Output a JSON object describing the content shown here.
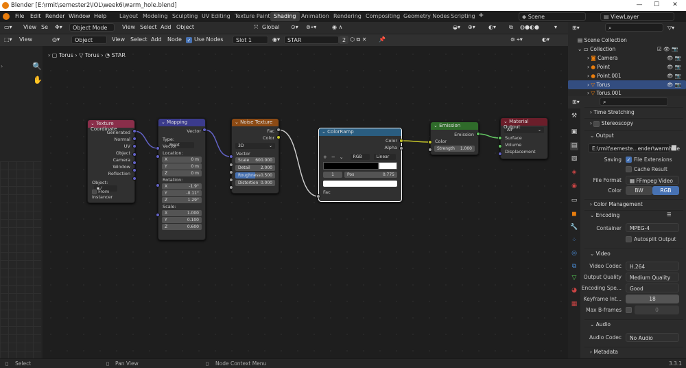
{
  "titlebar": {
    "title": "Blender [E:\\rmit\\semester2\\IOL\\week6\\warm_hole.blend]"
  },
  "menu": {
    "file": "File",
    "edit": "Edit",
    "render": "Render",
    "window": "Window",
    "help": "Help"
  },
  "workspaces": [
    "Layout",
    "Modeling",
    "Sculpting",
    "UV Editing",
    "Texture Paint",
    "Shading",
    "Animation",
    "Rendering",
    "Compositing",
    "Geometry Nodes",
    "Scripting"
  ],
  "top_right": {
    "scene": "Scene",
    "view_layer": "ViewLayer"
  },
  "viewport_header": {
    "view": "View",
    "se": "Se",
    "mode": "Object Mode",
    "view2": "View",
    "select": "Select",
    "add": "Add",
    "object": "Object",
    "transform": "Global"
  },
  "node_header": {
    "view": "View",
    "object": "Object",
    "view2": "View",
    "select": "Select",
    "add": "Add",
    "node": "Node",
    "use_nodes": "Use Nodes",
    "slot": "Slot 1",
    "material": "STAR",
    "users": "2"
  },
  "breadcrumb": {
    "object": "Torus",
    "mesh": "Torus",
    "material": "STAR"
  },
  "nodes": {
    "texcoord": {
      "title": "Texture Coordinate",
      "outputs": [
        "Generated",
        "Normal",
        "UV",
        "Object",
        "Camera",
        "Window",
        "Reflection"
      ],
      "object_label": "Object:",
      "from_instancer": "From Instancer"
    },
    "mapping": {
      "title": "Mapping",
      "output": "Vector",
      "type_label": "Type:",
      "type_value": "Point",
      "vector": "Vector",
      "location": "Location:",
      "loc": [
        [
          "X",
          "0 m"
        ],
        [
          "Y",
          "0 m"
        ],
        [
          "Z",
          "0 m"
        ]
      ],
      "rotation": "Rotation:",
      "rot": [
        [
          "X",
          "-1.9°"
        ],
        [
          "Y",
          "-0.11°"
        ],
        [
          "Z",
          "1.29°"
        ]
      ],
      "scale": "Scale:",
      "scl": [
        [
          "X",
          "1.000"
        ],
        [
          "Y",
          "0.100"
        ],
        [
          "Z",
          "0.600"
        ]
      ]
    },
    "noise": {
      "title": "Noise Texture",
      "fac": "Fac",
      "color": "Color",
      "dim": "3D",
      "vector": "Vector",
      "fields": [
        [
          "Scale",
          "600.000"
        ],
        [
          "Detail",
          "2.000"
        ],
        [
          "Roughness",
          "0.500"
        ],
        [
          "Distortion",
          "0.000"
        ]
      ],
      "roughness_fill": 0.5
    },
    "colorramp": {
      "title": "ColorRamp",
      "color": "Color",
      "alpha": "Alpha",
      "mode": "RGB",
      "interp": "Linear",
      "index": "1",
      "pos_label": "Pos",
      "pos": "0.775",
      "fac": "Fac"
    },
    "emission": {
      "title": "Emission",
      "output": "Emission",
      "color": "Color",
      "strength_label": "Strength",
      "strength": "1.000"
    },
    "output": {
      "title": "Material Output",
      "target": "All",
      "inputs": [
        "Surface",
        "Volume",
        "Displacement"
      ]
    }
  },
  "outliner": {
    "root": "Scene Collection",
    "collection": "Collection",
    "items": [
      "Camera",
      "Point",
      "Point.001",
      "Torus",
      "Torus.001"
    ]
  },
  "properties": {
    "time_stretching": "Time Stretching",
    "stereoscopy": "Stereoscopy",
    "output": "Output",
    "path": "E:\\rmit\\semeste...ender\\warmhole",
    "saving": "Saving",
    "file_extensions": "File Extensions",
    "cache_result": "Cache Result",
    "file_format_label": "File Format",
    "file_format": "FFmpeg Video",
    "color_label": "Color",
    "bw": "BW",
    "rgb": "RGB",
    "color_management": "Color Management",
    "encoding": "Encoding",
    "container_label": "Container",
    "container": "MPEG-4",
    "autosplit": "Autosplit Output",
    "video": "Video",
    "video_codec_label": "Video Codec",
    "video_codec": "H.264",
    "output_quality_label": "Output Quality",
    "output_quality": "Medium Quality",
    "encoding_speed_label": "Encoding Spe...",
    "encoding_speed": "Good",
    "keyframe_label": "Keyframe Int...",
    "keyframe": "18",
    "max_bframes_label": "Max B-frames",
    "max_bframes": "0",
    "audio": "Audio",
    "audio_codec_label": "Audio Codec",
    "audio_codec": "No Audio",
    "metadata": "Metadata"
  },
  "status": {
    "select": "Select",
    "pan": "Pan View",
    "context": "Node Context Menu",
    "version": "3.3.1"
  },
  "colors": {
    "accent": "#4772b3",
    "texcoord_header": "#8a2e4a",
    "mapping_header": "#3b3b8c",
    "noise_header": "#8c4a14",
    "ramp_header": "#2a5d80",
    "emission_header": "#2f6b2a",
    "output_header": "#6b1e2a"
  }
}
